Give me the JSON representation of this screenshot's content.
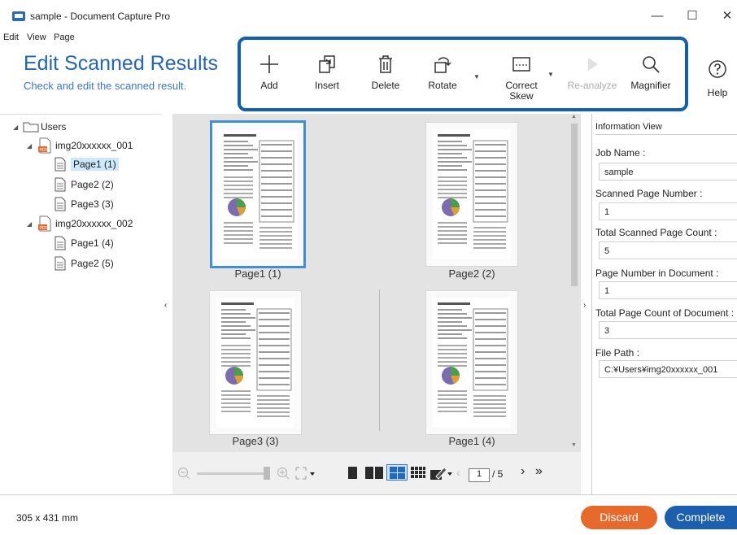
{
  "window": {
    "title": "sample - Document Capture Pro"
  },
  "menu": [
    "Edit",
    "View",
    "Page"
  ],
  "header": {
    "title": "Edit Scanned Results",
    "subtitle": "Check and edit the scanned result."
  },
  "toolbar": {
    "add": "Add",
    "insert": "Insert",
    "delete": "Delete",
    "rotate": "Rotate",
    "correct_skew_line1": "Correct",
    "correct_skew_line2": "Skew",
    "reanalyze": "Re-analyze",
    "magnifier": "Magnifier",
    "help": "Help"
  },
  "tree": {
    "root": "Users",
    "docs": [
      {
        "name": "img20xxxxxx_001",
        "pages": [
          "Page1 (1)",
          "Page2 (2)",
          "Page3 (3)"
        ]
      },
      {
        "name": "img20xxxxxx_002",
        "pages": [
          "Page1 (4)",
          "Page2 (5)"
        ]
      }
    ],
    "selected": "Page1 (1)"
  },
  "thumbnails": [
    "Page1 (1)",
    "Page2 (2)",
    "Page3 (3)",
    "Page1 (4)"
  ],
  "pager": {
    "current": "1",
    "total": "/ 5"
  },
  "info": {
    "heading": "Information View",
    "job_name_label": "Job Name :",
    "job_name": "sample",
    "scanned_page_number_label": "Scanned Page Number :",
    "scanned_page_number": "1",
    "total_scanned_label": "Total Scanned Page Count :",
    "total_scanned": "5",
    "page_in_doc_label": "Page Number in Document :",
    "page_in_doc": "1",
    "total_doc_label": "Total Page Count of Document :",
    "total_doc": "3",
    "file_path_label": "File Path :",
    "file_path": "C:¥Users¥img20xxxxxx_001"
  },
  "footer": {
    "dimensions": "305 x 431 mm",
    "discard": "Discard",
    "complete": "Complete"
  },
  "colors": {
    "accent": "#2465b5",
    "toolbar_border": "#0f5fae",
    "discard": "#e8692c",
    "complete": "#1b5fae",
    "selection": "#cce8ff"
  }
}
